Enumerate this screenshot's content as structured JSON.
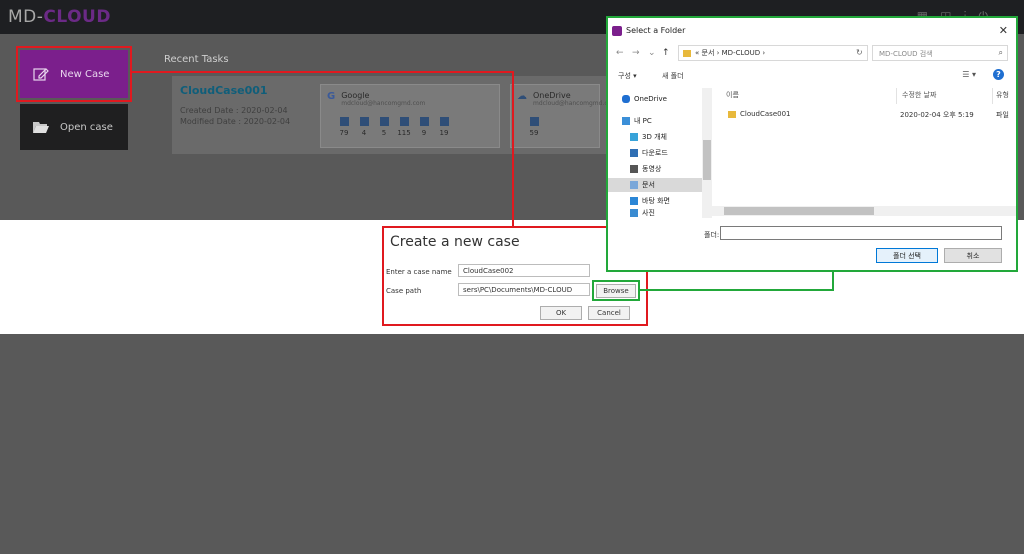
{
  "app": {
    "logo_main": "MD-",
    "logo_accent": "CLOUD"
  },
  "home": {
    "new_case_label": "New Case",
    "open_case_label": "Open case",
    "recent_tasks_title": "Recent Tasks",
    "recent_case": {
      "name": "CloudCase001",
      "created": "Created Date : 2020-02-04",
      "modified": "Modified Date : 2020-02-04"
    },
    "services": [
      {
        "name": "Google",
        "account": "mdcloud@hancomgmd.com",
        "counts": [
          "79",
          "4",
          "5",
          "115",
          "9",
          "19"
        ]
      },
      {
        "name": "OneDrive",
        "account": "mdcloud@hancomgmd.com",
        "counts": [
          "59"
        ]
      }
    ]
  },
  "create_dialog": {
    "title": "Create a new case",
    "case_name_label": "Enter a case name",
    "case_name_value": "CloudCase002",
    "case_path_label": "Case path",
    "case_path_value": "sers\\PC\\Documents\\MD-CLOUD",
    "browse_label": "Browse",
    "ok_label": "OK",
    "cancel_label": "Cancel"
  },
  "select_folder": {
    "title": "Select a Folder",
    "close_glyph": "✕",
    "address": "« 문서 › MD-CLOUD ›",
    "search_placeholder": "MD-CLOUD 검색",
    "organize_label": "구성 ▾",
    "new_folder_label": "새 폴더",
    "help_glyph": "?",
    "tree": [
      {
        "label": "OneDrive",
        "icon": "cloud-icon",
        "color": "#1f6fd1"
      },
      {
        "label": "내 PC",
        "icon": "computer-icon",
        "color": "#3b8fd8"
      },
      {
        "label": "3D 개체",
        "icon": "cube-icon",
        "color": "#38a3d9"
      },
      {
        "label": "다운로드",
        "icon": "download-icon",
        "color": "#2f6fb4"
      },
      {
        "label": "동영상",
        "icon": "film-icon",
        "color": "#555555"
      },
      {
        "label": "문서",
        "icon": "document-icon",
        "color": "#7aa7d9",
        "selected": true
      },
      {
        "label": "바탕 화면",
        "icon": "desktop-icon",
        "color": "#2b86d6"
      },
      {
        "label": "사진",
        "icon": "picture-icon",
        "color": "#3a8bd1"
      }
    ],
    "columns": [
      "이름",
      "수정한 날짜",
      "유형"
    ],
    "files": [
      {
        "name": "CloudCase001",
        "modified": "2020-02-04 오후 5:19",
        "type": "파일"
      }
    ],
    "folder_label": "폴더:",
    "folder_value": "",
    "select_button": "폴더 선택",
    "cancel_button": "취소"
  },
  "colors": {
    "highlight_red": "#e0191f",
    "highlight_green": "#22a83a",
    "brand_purple": "#7b1f8c"
  }
}
